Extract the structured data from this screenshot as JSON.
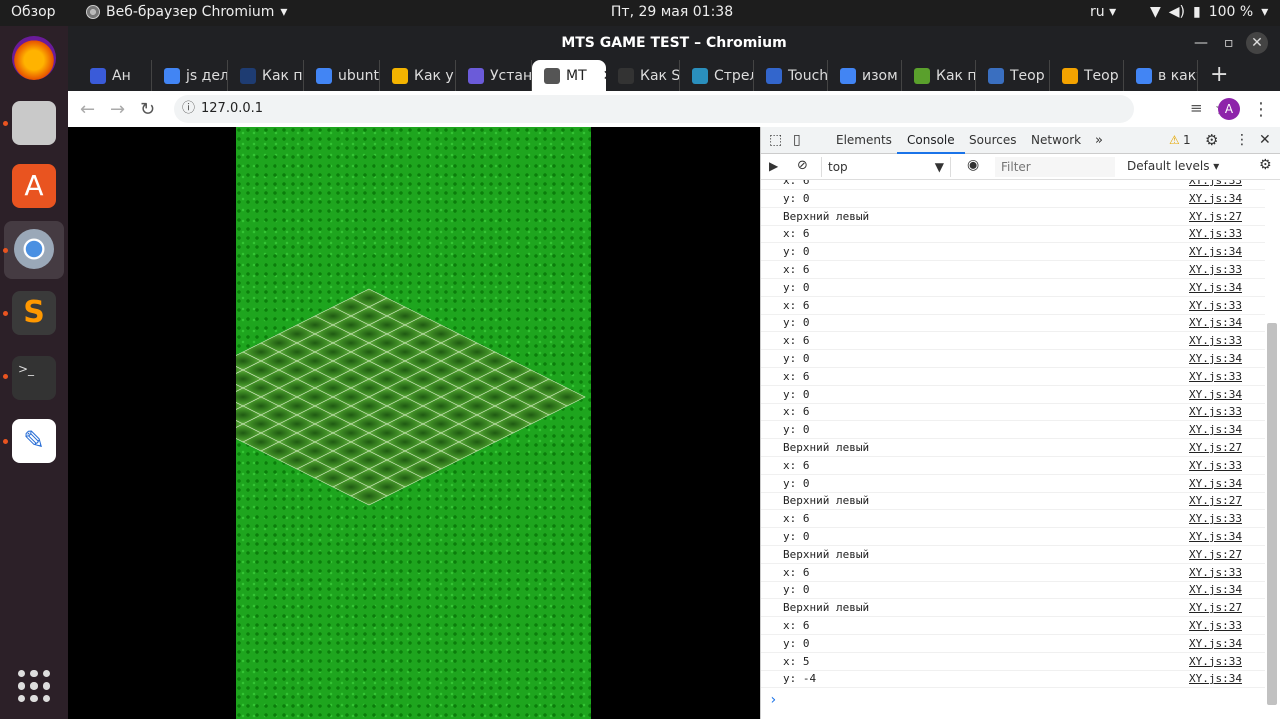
{
  "topbar": {
    "activities": "Обзор",
    "app_name": "Веб-браузер Chromium",
    "clock": "Пт, 29 мая  01:38",
    "lang": "ru",
    "battery": "100 %"
  },
  "window": {
    "title": "MTS GAME TEST – Chromium"
  },
  "tabs": [
    {
      "label": "Ан",
      "color": "#3a5bd9"
    },
    {
      "label": "js дел",
      "color": "#4285f4"
    },
    {
      "label": "Как п",
      "color": "#1e3c72"
    },
    {
      "label": "ubunt",
      "color": "#4285f4"
    },
    {
      "label": "Как у",
      "color": "#f4b400"
    },
    {
      "label": "Устан",
      "color": "#6b5bd9"
    },
    {
      "label": "MT",
      "color": "#555555",
      "active": true
    },
    {
      "label": "Как S",
      "color": "#333333"
    },
    {
      "label": "Стрел",
      "color": "#2a8fbd"
    },
    {
      "label": "Touch",
      "color": "#3366cc"
    },
    {
      "label": "изом",
      "color": "#4285f4"
    },
    {
      "label": "Как п",
      "color": "#5aa02c"
    },
    {
      "label": "Теор",
      "color": "#3a6fc0"
    },
    {
      "label": "Теор",
      "color": "#f4a300"
    },
    {
      "label": "в каку",
      "color": "#4285f4"
    }
  ],
  "toolbar": {
    "url": "127.0.0.1",
    "avatar_letter": "A"
  },
  "devtools": {
    "tabs": [
      "Elements",
      "Console",
      "Sources",
      "Network"
    ],
    "active_tab": "Console",
    "warnings": "1",
    "context": "top",
    "filter_placeholder": "Filter",
    "levels": "Default levels"
  },
  "console_rows": [
    {
      "msg": "x: 6",
      "src": "XY.js:33"
    },
    {
      "msg": "y: 0",
      "src": "XY.js:34"
    },
    {
      "msg": "Верхний левый",
      "src": "XY.js:27"
    },
    {
      "msg": "x: 6",
      "src": "XY.js:33"
    },
    {
      "msg": "y: 0",
      "src": "XY.js:34"
    },
    {
      "msg": "x: 6",
      "src": "XY.js:33"
    },
    {
      "msg": "y: 0",
      "src": "XY.js:34"
    },
    {
      "msg": "x: 6",
      "src": "XY.js:33"
    },
    {
      "msg": "y: 0",
      "src": "XY.js:34"
    },
    {
      "msg": "x: 6",
      "src": "XY.js:33"
    },
    {
      "msg": "y: 0",
      "src": "XY.js:34"
    },
    {
      "msg": "x: 6",
      "src": "XY.js:33"
    },
    {
      "msg": "y: 0",
      "src": "XY.js:34"
    },
    {
      "msg": "x: 6",
      "src": "XY.js:33"
    },
    {
      "msg": "y: 0",
      "src": "XY.js:34"
    },
    {
      "msg": "Верхний левый",
      "src": "XY.js:27"
    },
    {
      "msg": "x: 6",
      "src": "XY.js:33"
    },
    {
      "msg": "y: 0",
      "src": "XY.js:34"
    },
    {
      "msg": "Верхний левый",
      "src": "XY.js:27"
    },
    {
      "msg": "x: 6",
      "src": "XY.js:33"
    },
    {
      "msg": "y: 0",
      "src": "XY.js:34"
    },
    {
      "msg": "Верхний левый",
      "src": "XY.js:27"
    },
    {
      "msg": "x: 6",
      "src": "XY.js:33"
    },
    {
      "msg": "y: 0",
      "src": "XY.js:34"
    },
    {
      "msg": "Верхний левый",
      "src": "XY.js:27"
    },
    {
      "msg": "x: 6",
      "src": "XY.js:33"
    },
    {
      "msg": "y: 0",
      "src": "XY.js:34"
    },
    {
      "msg": "x: 5",
      "src": "XY.js:33"
    },
    {
      "msg": "y: -4",
      "src": "XY.js:34"
    }
  ],
  "colors": {
    "grass": "#1ea51e",
    "tile": "#2f7d1f",
    "tile_border": "#cfe8c0"
  }
}
